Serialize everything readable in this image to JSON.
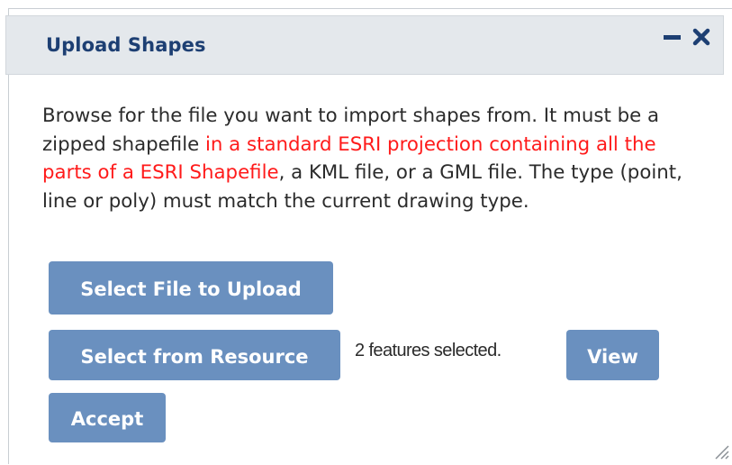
{
  "dialog": {
    "title": "Upload Shapes",
    "minimize_icon": "minimize-icon",
    "close_icon": "close-icon"
  },
  "description": {
    "part1": "Browse for the file you want to import shapes from. It must be a zipped shapefile ",
    "highlight": "in a standard ESRI projection containing all the parts of a ESRI Shapefile",
    "part2": ", a KML file, or a GML file. The type (point, line or poly) must match the current drawing type.",
    "highlight_color": "#ff1a1a"
  },
  "buttons": {
    "select_file": "Select File to Upload",
    "select_resource": "Select from Resource",
    "view": "View",
    "accept": "Accept"
  },
  "status": {
    "selection_text": "2 features selected."
  },
  "colors": {
    "header_bg": "#e4e8ec",
    "title": "#1d3f73",
    "button_bg": "#6a90bf"
  }
}
